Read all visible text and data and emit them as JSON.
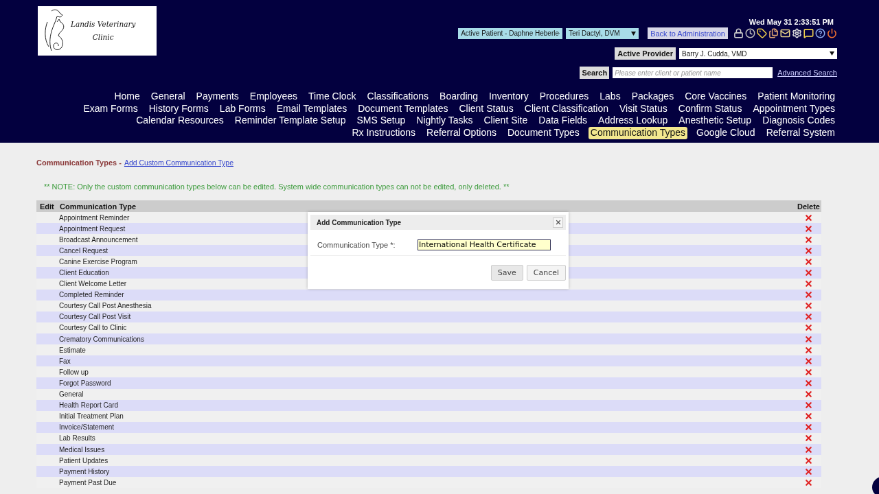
{
  "logo": {
    "lines": [
      "Landis Veterinary",
      "Clinic"
    ]
  },
  "datetime": "Wed May 31 2:33:51 PM",
  "patient_select": "Active Patient - Daphne Heberle",
  "doctor_select": "Teri Dactyl, DVM",
  "back_button": "Back to Administration",
  "active_provider": {
    "label": "Active Provider",
    "value": "Barry J. Cudda, VMD"
  },
  "search": {
    "button": "Search",
    "placeholder": "Please enter client or patient name",
    "advanced": "Advanced Search"
  },
  "nav_rows": [
    [
      {
        "label": "Home",
        "selected": false
      },
      {
        "label": "General",
        "selected": false
      },
      {
        "label": "Payments",
        "selected": false
      },
      {
        "label": "Employees",
        "selected": false
      },
      {
        "label": "Time Clock",
        "selected": false
      },
      {
        "label": "Classifications",
        "selected": false
      },
      {
        "label": "Boarding",
        "selected": false
      },
      {
        "label": "Inventory",
        "selected": false
      },
      {
        "label": "Procedures",
        "selected": false
      },
      {
        "label": "Labs",
        "selected": false
      },
      {
        "label": "Packages",
        "selected": false
      },
      {
        "label": "Core Vaccines",
        "selected": false
      },
      {
        "label": "Patient Monitoring",
        "selected": false
      }
    ],
    [
      {
        "label": "Exam Forms",
        "selected": false
      },
      {
        "label": "History Forms",
        "selected": false
      },
      {
        "label": "Lab Forms",
        "selected": false
      },
      {
        "label": "Email Templates",
        "selected": false
      },
      {
        "label": "Document Templates",
        "selected": false
      },
      {
        "label": "Client Status",
        "selected": false
      },
      {
        "label": "Client Classification",
        "selected": false
      },
      {
        "label": "Visit Status",
        "selected": false
      },
      {
        "label": "Confirm Status",
        "selected": false
      },
      {
        "label": "Appointment Types",
        "selected": false
      }
    ],
    [
      {
        "label": "Calendar Resources",
        "selected": false
      },
      {
        "label": "Reminder Template Setup",
        "selected": false
      },
      {
        "label": "SMS Setup",
        "selected": false
      },
      {
        "label": "Nightly Tasks",
        "selected": false
      },
      {
        "label": "Client Site",
        "selected": false
      },
      {
        "label": "Data Fields",
        "selected": false
      },
      {
        "label": "Address Lookup",
        "selected": false
      },
      {
        "label": "Anesthetic Setup",
        "selected": false
      },
      {
        "label": "Diagnosis Codes",
        "selected": false
      }
    ],
    [
      {
        "label": "Rx Instructions",
        "selected": false
      },
      {
        "label": "Referral Options",
        "selected": false
      },
      {
        "label": "Document Types",
        "selected": false
      },
      {
        "label": "Communication Types",
        "selected": true
      },
      {
        "label": "Google Cloud",
        "selected": false
      },
      {
        "label": "Referral System",
        "selected": false
      }
    ]
  ],
  "page_title": "Communication Types -",
  "add_link": "Add Custom Communication Type",
  "note": "** NOTE: Only the custom communication types below can be edited. System wide communication types can not be edited, only deleted. **",
  "table": {
    "columns": [
      "Edit",
      "Communication Type",
      "Delete"
    ],
    "rows": [
      "Appointment Reminder",
      "Appointment Request",
      "Broadcast Announcement",
      "Cancel Request",
      "Canine Exercise Program",
      "Client Education",
      "Client Welcome Letter",
      "Completed Reminder",
      "Courtesy Call Post Anesthesia",
      "Courtesy Call Post Visit",
      "Courtesy Call to Clinic",
      "Crematory Communications",
      "Estimate",
      "Fax",
      "Follow up",
      "Forgot Password",
      "General",
      "Health Report Card",
      "Initial Treatment Plan",
      "Invoice/Statement",
      "Lab Results",
      "Medical Issues",
      "Patient Updates",
      "Payment History",
      "Payment Past Due"
    ]
  },
  "dialog": {
    "title": "Add Communication Type",
    "label": "Communication Type *:",
    "value": "International Health Certificate",
    "buttons": [
      "Save",
      "Cancel"
    ]
  }
}
